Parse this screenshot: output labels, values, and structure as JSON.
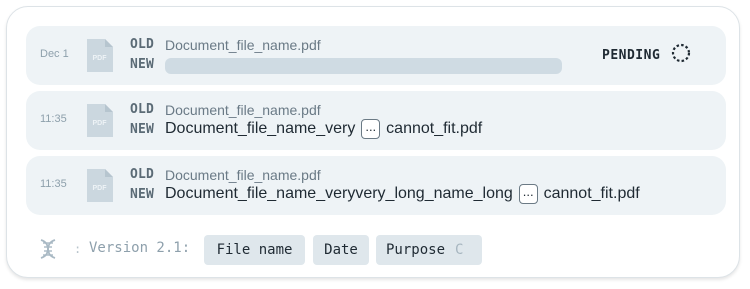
{
  "rows": [
    {
      "timestamp": "Dec 1",
      "old_label": "OLD",
      "new_label": "NEW",
      "old_name": "Document_file_name.pdf",
      "status": "PENDING"
    },
    {
      "timestamp": "11:35",
      "old_label": "OLD",
      "new_label": "NEW",
      "old_name": "Document_file_name.pdf",
      "new_name_start": "Document_file_name_very",
      "ellipsis": "...",
      "new_name_end": "cannot_fit.pdf"
    },
    {
      "timestamp": "11:35",
      "old_label": "OLD",
      "new_label": "NEW",
      "old_name": "Document_file_name.pdf",
      "new_name_start": "Document_file_name_veryvery_long_name_long",
      "ellipsis": "...",
      "new_name_end": "cannot_fit.pdf"
    }
  ],
  "icons": {
    "file": "pdf-file-icon",
    "spinner": "loading-spinner-icon",
    "dna": "dna-icon"
  },
  "footer": {
    "colon": ":",
    "version": "Version 2.1:",
    "chips": [
      {
        "label": "File name"
      },
      {
        "label": "Date"
      },
      {
        "label": "Purpose",
        "suffix": "C"
      }
    ]
  },
  "colors": {
    "row_bg": "#eef3f6",
    "chip_bg": "#dfe7ec",
    "muted": "#8ea0ac",
    "text": "#1f2a33"
  }
}
